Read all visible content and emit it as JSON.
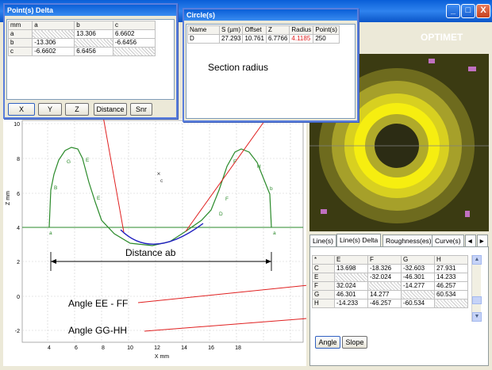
{
  "window_controls": {
    "minimize": "_",
    "maximize": "□",
    "close": "X"
  },
  "logo": "OPTIMET",
  "points_delta": {
    "title": "Point(s) Delta",
    "columns": [
      "mm",
      "a",
      "b",
      "c"
    ],
    "rows": [
      {
        "label": "a",
        "a": "",
        "b": "13.306",
        "c": "6.6602"
      },
      {
        "label": "b",
        "a": "-13.306",
        "b": "",
        "c": "-6.6456"
      },
      {
        "label": "c",
        "a": "-6.6602",
        "b": "6.6456",
        "c": ""
      }
    ],
    "buttons": [
      "X",
      "Y",
      "Z",
      "Distance",
      "Snr"
    ]
  },
  "circles": {
    "title": "Circle(s)",
    "columns": [
      "Name",
      "S (µm)",
      "Offset",
      "Z",
      "Radius",
      "Point(s)"
    ],
    "row": {
      "name": "D",
      "s": "27.293",
      "offset": "10.761",
      "z": "6.7766",
      "radius": "4.1185",
      "points": "250"
    },
    "radius_color": "#e02020"
  },
  "annotations": {
    "section_radius": "Section radius",
    "distance_ab": "Distance ab",
    "angle_ee_ff": "Angle EE - FF",
    "angle_gg_hh": "Angle GG-HH"
  },
  "plot": {
    "ylabel": "Z mm",
    "xlabel": "X mm",
    "y_ticks": [
      "10",
      "8",
      "6",
      "4",
      "2",
      "0",
      "-2"
    ],
    "x_ticks": [
      "4",
      "6",
      "8",
      "10",
      "12",
      "14",
      "16",
      "18"
    ],
    "point_labels": [
      "G",
      "E",
      "B",
      "E",
      "a",
      "c",
      "F",
      "F",
      "H",
      "D",
      "b",
      "a"
    ],
    "profile_color": "#2a8a2a",
    "circle_color": "#2020c0",
    "arrow_color": "#e02020"
  },
  "line_tabs": {
    "tabs": [
      "Line(s)",
      "Line(s) Delta",
      "Roughness(es)",
      "Curve(s)"
    ],
    "active": "Line(s) Delta",
    "nav": [
      "◄",
      "►"
    ]
  },
  "lines_delta": {
    "columns": [
      "*",
      "E",
      "F",
      "G",
      "H"
    ],
    "rows": [
      {
        "label": "C",
        "e": "13.698",
        "f": "-18.326",
        "g": "-32.603",
        "h": "27.931"
      },
      {
        "label": "E",
        "e": "",
        "f": "-32.024",
        "g": "-46.301",
        "h": "14.233"
      },
      {
        "label": "F",
        "e": "32.024",
        "f": "",
        "g": "-14.277",
        "h": "46.257"
      },
      {
        "label": "G",
        "e": "46.301",
        "f": "14.277",
        "g": "",
        "h": "60.534"
      },
      {
        "label": "H",
        "e": "-14.233",
        "f": "-46.257",
        "g": "-60.534",
        "h": ""
      }
    ],
    "buttons": [
      "Angle",
      "Slope"
    ]
  }
}
